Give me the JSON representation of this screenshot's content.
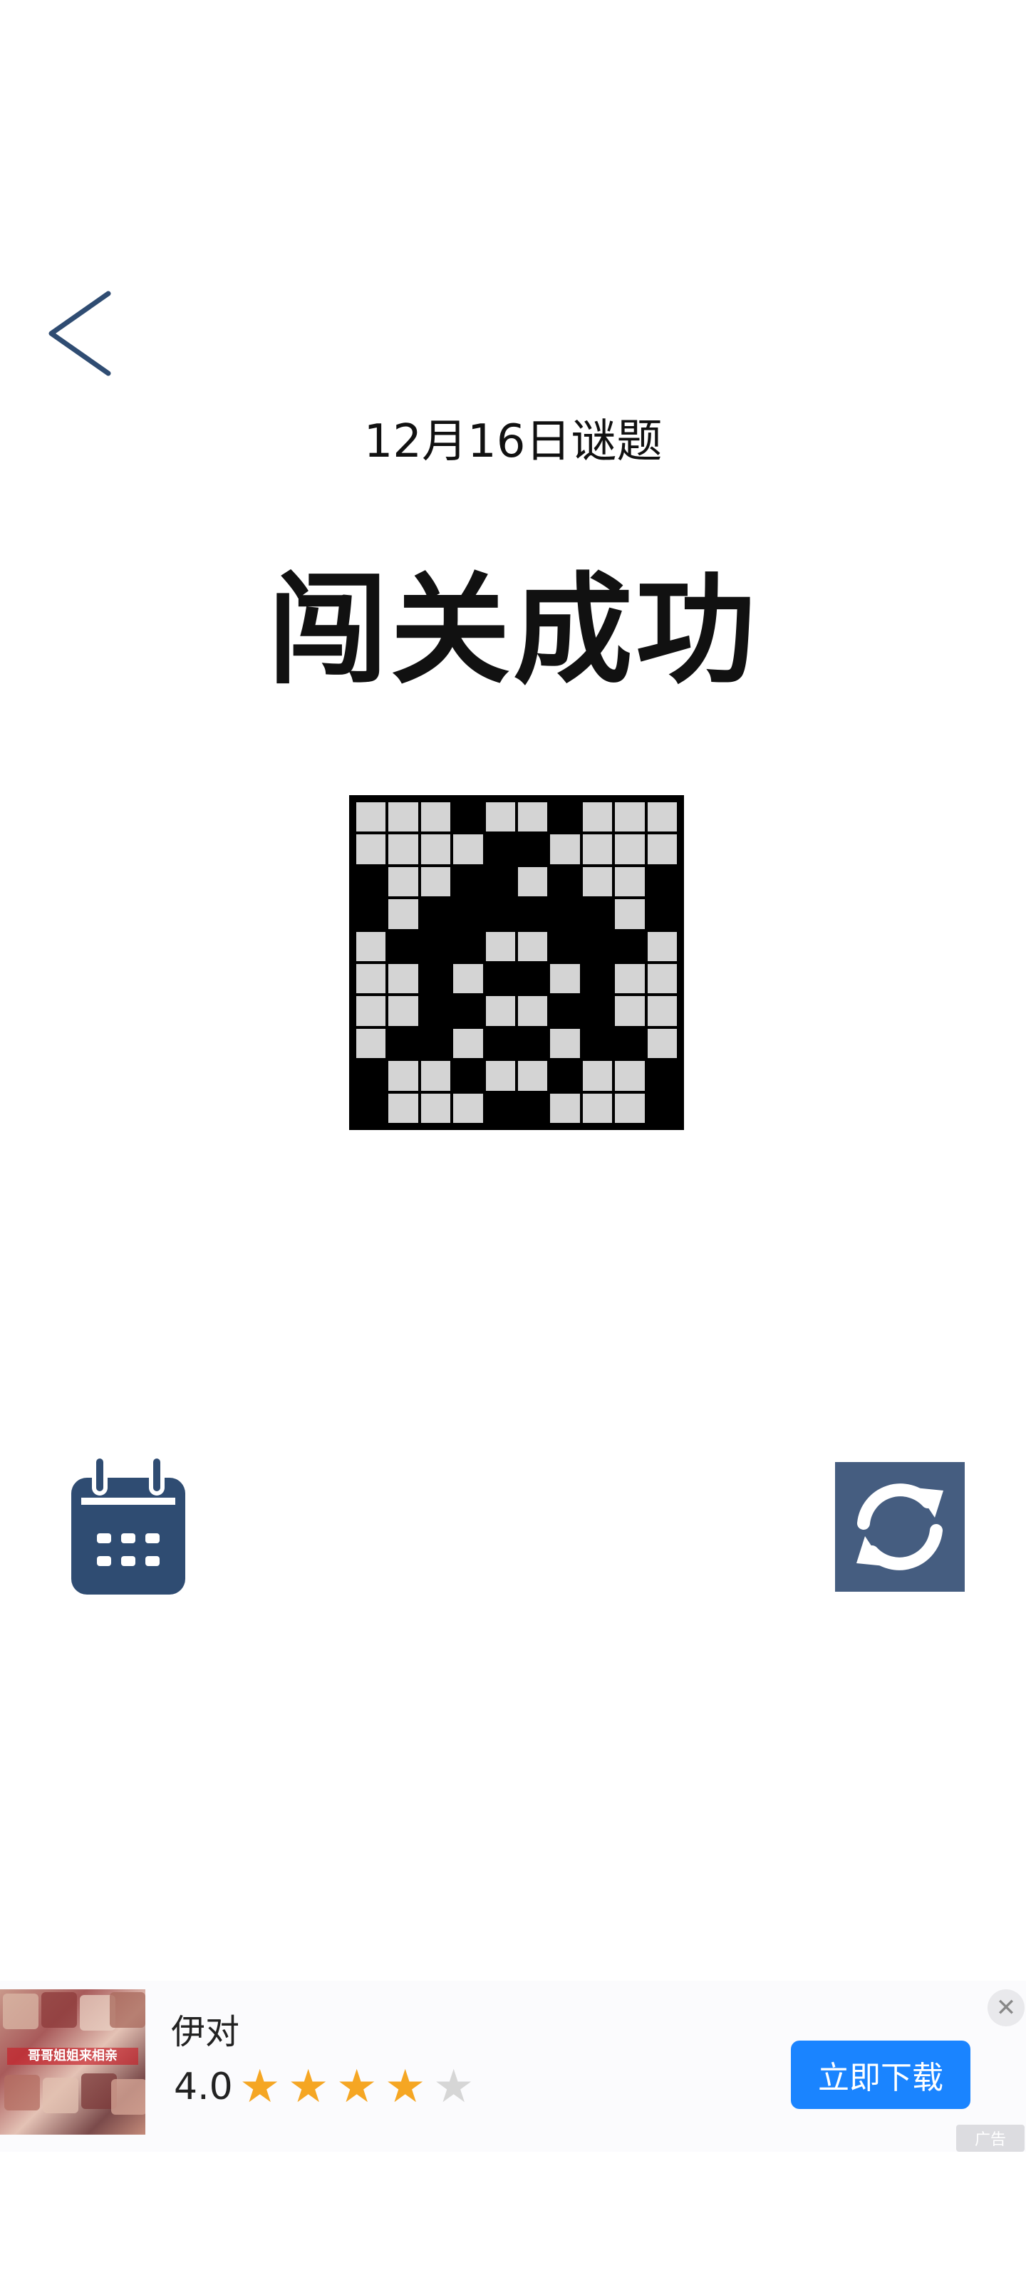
{
  "header": {
    "back_icon": "chevron-left-icon",
    "date_title": "12月16日谜题",
    "result_title": "闯关成功"
  },
  "puzzle": {
    "rows": 10,
    "cols": 10,
    "grid": [
      [
        0,
        0,
        0,
        1,
        0,
        0,
        1,
        0,
        0,
        0
      ],
      [
        0,
        0,
        0,
        0,
        1,
        1,
        0,
        0,
        0,
        0
      ],
      [
        1,
        0,
        0,
        1,
        1,
        0,
        1,
        0,
        0,
        1
      ],
      [
        1,
        0,
        1,
        1,
        1,
        1,
        1,
        1,
        0,
        1
      ],
      [
        0,
        1,
        1,
        1,
        0,
        0,
        1,
        1,
        1,
        0
      ],
      [
        0,
        0,
        1,
        0,
        1,
        1,
        0,
        1,
        0,
        0
      ],
      [
        0,
        0,
        1,
        1,
        0,
        0,
        1,
        1,
        0,
        0
      ],
      [
        0,
        1,
        1,
        0,
        1,
        1,
        0,
        1,
        1,
        0
      ],
      [
        1,
        0,
        0,
        1,
        0,
        0,
        1,
        0,
        0,
        1
      ],
      [
        1,
        0,
        0,
        0,
        1,
        1,
        0,
        0,
        0,
        1
      ]
    ],
    "colors": {
      "filled": "#000000",
      "empty": "#d4d4d4",
      "border": "#000000"
    }
  },
  "controls": {
    "calendar_icon": "calendar-icon",
    "calendar_color": "#2f4c72",
    "refresh_icon": "refresh-icon",
    "refresh_color": "#455d80"
  },
  "ad": {
    "app_name": "伊对",
    "rating": "4.0",
    "stars_filled": 4,
    "stars_total": 5,
    "thumbnail_caption": "哥哥姐姐来相亲",
    "cta_label": "立即下载",
    "close_label": "✕",
    "badge_label": "广告",
    "cta_color": "#1a84ff",
    "star_color": "#f5a623"
  }
}
